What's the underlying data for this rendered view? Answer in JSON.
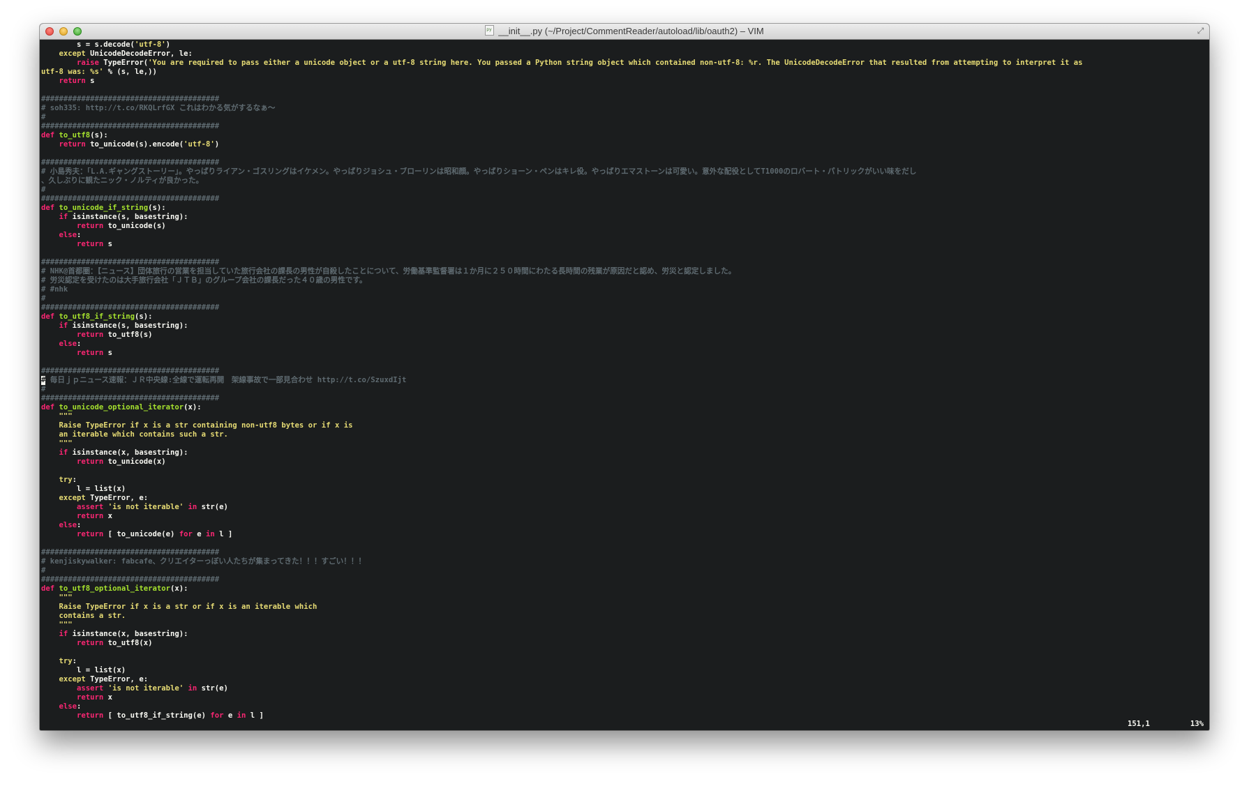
{
  "window": {
    "title": "__init__.py (~/Project/CommentReader/autoload/lib/oauth2) – VIM"
  },
  "status": {
    "position": "151,1",
    "percent": "13%"
  },
  "colors": {
    "background": "#1b1d1e",
    "keyword": "#f92672",
    "function": "#a6e22e",
    "string": "#e6db74",
    "comment": "#5e6a70",
    "text": "#f8f8f2"
  },
  "lines": [
    [
      [
        "tx",
        "        s = s.decode("
      ],
      [
        "str",
        "'utf-8'"
      ],
      [
        "tx",
        ")"
      ]
    ],
    [
      [
        "kw2",
        "    except"
      ],
      [
        "tx",
        " UnicodeDecodeError, le:"
      ]
    ],
    [
      [
        "kw",
        "        raise"
      ],
      [
        "tx",
        " TypeError("
      ],
      [
        "str",
        "'You are required to pass either a unicode object or a utf-8 string here. You passed a Python string object which contained non-utf-8: %r. The UnicodeDecodeError that resulted from attempting to interpret it as"
      ]
    ],
    [
      [
        "str",
        "utf-8 was: %s'"
      ],
      [
        "tx",
        " % (s, le,))"
      ]
    ],
    [
      [
        "kw",
        "    return"
      ],
      [
        "tx",
        " s"
      ]
    ],
    [],
    [
      [
        "cm",
        "########################################"
      ]
    ],
    [
      [
        "cm",
        "# soh335: http://t.co/RKQLrfGX これはわかる気がするなぁ〜"
      ]
    ],
    [
      [
        "cm",
        "#"
      ]
    ],
    [
      [
        "cm",
        "########################################"
      ]
    ],
    [
      [
        "kw",
        "def"
      ],
      [
        "tx",
        " "
      ],
      [
        "fn",
        "to_utf8"
      ],
      [
        "tx",
        "(s):"
      ]
    ],
    [
      [
        "kw",
        "    return"
      ],
      [
        "tx",
        " to_unicode(s).encode("
      ],
      [
        "str",
        "'utf-8'"
      ],
      [
        "tx",
        ")"
      ]
    ],
    [],
    [
      [
        "cm",
        "########################################"
      ]
    ],
    [
      [
        "cm",
        "# 小島秀夫：「L.A.ギャングストーリー」。やっぱりライアン・ゴスリングはイケメン。やっぱりジョシュ・ブローリンは昭和顔。やっぱりショーン・ペンはキレ役。やっぱりエマストーンは可愛い。意外な配役としてT1000のロバート・パトリックがいい味をだし"
      ]
    ],
    [
      [
        "cm",
        "、久しぶりに観たニック・ノルティが良かった。"
      ]
    ],
    [
      [
        "cm",
        "#"
      ]
    ],
    [
      [
        "cm",
        "########################################"
      ]
    ],
    [
      [
        "kw",
        "def"
      ],
      [
        "tx",
        " "
      ],
      [
        "fn",
        "to_unicode_if_string"
      ],
      [
        "tx",
        "(s):"
      ]
    ],
    [
      [
        "kw",
        "    if"
      ],
      [
        "tx",
        " isinstance(s, basestring):"
      ]
    ],
    [
      [
        "kw",
        "        return"
      ],
      [
        "tx",
        " to_unicode(s)"
      ]
    ],
    [
      [
        "kw",
        "    else"
      ],
      [
        "tx",
        ":"
      ]
    ],
    [
      [
        "kw",
        "        return"
      ],
      [
        "tx",
        " s"
      ]
    ],
    [],
    [
      [
        "cm",
        "########################################"
      ]
    ],
    [
      [
        "cm",
        "# NHK@首都圏：【ニュース】団体旅行の営業を担当していた旅行会社の課長の男性が自殺したことについて、労働基準監督署は１か月に２５０時間にわたる長時間の残業が原因だと認め、労災と認定しました。"
      ]
    ],
    [
      [
        "cm",
        "# 労災認定を受けたのは大手旅行会社「ＪＴＢ」のグループ会社の課長だった４０歳の男性です。"
      ]
    ],
    [
      [
        "cm",
        "# #nhk"
      ]
    ],
    [
      [
        "cm",
        "#"
      ]
    ],
    [
      [
        "cm",
        "########################################"
      ]
    ],
    [
      [
        "kw",
        "def"
      ],
      [
        "tx",
        " "
      ],
      [
        "fn",
        "to_utf8_if_string"
      ],
      [
        "tx",
        "(s):"
      ]
    ],
    [
      [
        "kw",
        "    if"
      ],
      [
        "tx",
        " isinstance(s, basestring):"
      ]
    ],
    [
      [
        "kw",
        "        return"
      ],
      [
        "tx",
        " to_utf8(s)"
      ]
    ],
    [
      [
        "kw",
        "    else"
      ],
      [
        "tx",
        ":"
      ]
    ],
    [
      [
        "kw",
        "        return"
      ],
      [
        "tx",
        " s"
      ]
    ],
    [],
    [
      [
        "cm",
        "########################################"
      ]
    ],
    [
      [
        "cursor",
        "#"
      ],
      [
        "cm",
        " 毎日ｊｐニュース速報：ＪＲ中央線:全線で運転再開　架線事故で一部見合わせ http://t.co/SzuxdIjt"
      ]
    ],
    [
      [
        "cm",
        "#"
      ]
    ],
    [
      [
        "cm",
        "########################################"
      ]
    ],
    [
      [
        "kw",
        "def"
      ],
      [
        "tx",
        " "
      ],
      [
        "fn",
        "to_unicode_optional_iterator"
      ],
      [
        "tx",
        "(x):"
      ]
    ],
    [
      [
        "str",
        "    \"\"\""
      ]
    ],
    [
      [
        "str",
        "    Raise TypeError if x is a str containing non-utf8 bytes or if x is"
      ]
    ],
    [
      [
        "str",
        "    an iterable which contains such a str."
      ]
    ],
    [
      [
        "str",
        "    \"\"\""
      ]
    ],
    [
      [
        "kw",
        "    if"
      ],
      [
        "tx",
        " isinstance(x, basestring):"
      ]
    ],
    [
      [
        "kw",
        "        return"
      ],
      [
        "tx",
        " to_unicode(x)"
      ]
    ],
    [],
    [
      [
        "kw2",
        "    try"
      ],
      [
        "tx",
        ":"
      ]
    ],
    [
      [
        "tx",
        "        l = list(x)"
      ]
    ],
    [
      [
        "kw2",
        "    except"
      ],
      [
        "tx",
        " TypeError, e:"
      ]
    ],
    [
      [
        "kw",
        "        assert"
      ],
      [
        "tx",
        " "
      ],
      [
        "str",
        "'is not iterable'"
      ],
      [
        "tx",
        " "
      ],
      [
        "kw",
        "in"
      ],
      [
        "tx",
        " str(e)"
      ]
    ],
    [
      [
        "kw",
        "        return"
      ],
      [
        "tx",
        " x"
      ]
    ],
    [
      [
        "kw",
        "    else"
      ],
      [
        "tx",
        ":"
      ]
    ],
    [
      [
        "kw",
        "        return"
      ],
      [
        "tx",
        " [ to_unicode(e) "
      ],
      [
        "kw",
        "for"
      ],
      [
        "tx",
        " e "
      ],
      [
        "kw",
        "in"
      ],
      [
        "tx",
        " l ]"
      ]
    ],
    [],
    [
      [
        "cm",
        "########################################"
      ]
    ],
    [
      [
        "cm",
        "# kenjiskywalker: fabcafe、クリエイターっぽい人たちが集まってきた！！！すごい！！！"
      ]
    ],
    [
      [
        "cm",
        "#"
      ]
    ],
    [
      [
        "cm",
        "########################################"
      ]
    ],
    [
      [
        "kw",
        "def"
      ],
      [
        "tx",
        " "
      ],
      [
        "fn",
        "to_utf8_optional_iterator"
      ],
      [
        "tx",
        "(x):"
      ]
    ],
    [
      [
        "str",
        "    \"\"\""
      ]
    ],
    [
      [
        "str",
        "    Raise TypeError if x is a str or if x is an iterable which"
      ]
    ],
    [
      [
        "str",
        "    contains a str."
      ]
    ],
    [
      [
        "str",
        "    \"\"\""
      ]
    ],
    [
      [
        "kw",
        "    if"
      ],
      [
        "tx",
        " isinstance(x, basestring):"
      ]
    ],
    [
      [
        "kw",
        "        return"
      ],
      [
        "tx",
        " to_utf8(x)"
      ]
    ],
    [],
    [
      [
        "kw2",
        "    try"
      ],
      [
        "tx",
        ":"
      ]
    ],
    [
      [
        "tx",
        "        l = list(x)"
      ]
    ],
    [
      [
        "kw2",
        "    except"
      ],
      [
        "tx",
        " TypeError, e:"
      ]
    ],
    [
      [
        "kw",
        "        assert"
      ],
      [
        "tx",
        " "
      ],
      [
        "str",
        "'is not iterable'"
      ],
      [
        "tx",
        " "
      ],
      [
        "kw",
        "in"
      ],
      [
        "tx",
        " str(e)"
      ]
    ],
    [
      [
        "kw",
        "        return"
      ],
      [
        "tx",
        " x"
      ]
    ],
    [
      [
        "kw",
        "    else"
      ],
      [
        "tx",
        ":"
      ]
    ],
    [
      [
        "kw",
        "        return"
      ],
      [
        "tx",
        " [ to_utf8_if_string(e) "
      ],
      [
        "kw",
        "for"
      ],
      [
        "tx",
        " e "
      ],
      [
        "kw",
        "in"
      ],
      [
        "tx",
        " l ]"
      ]
    ]
  ]
}
